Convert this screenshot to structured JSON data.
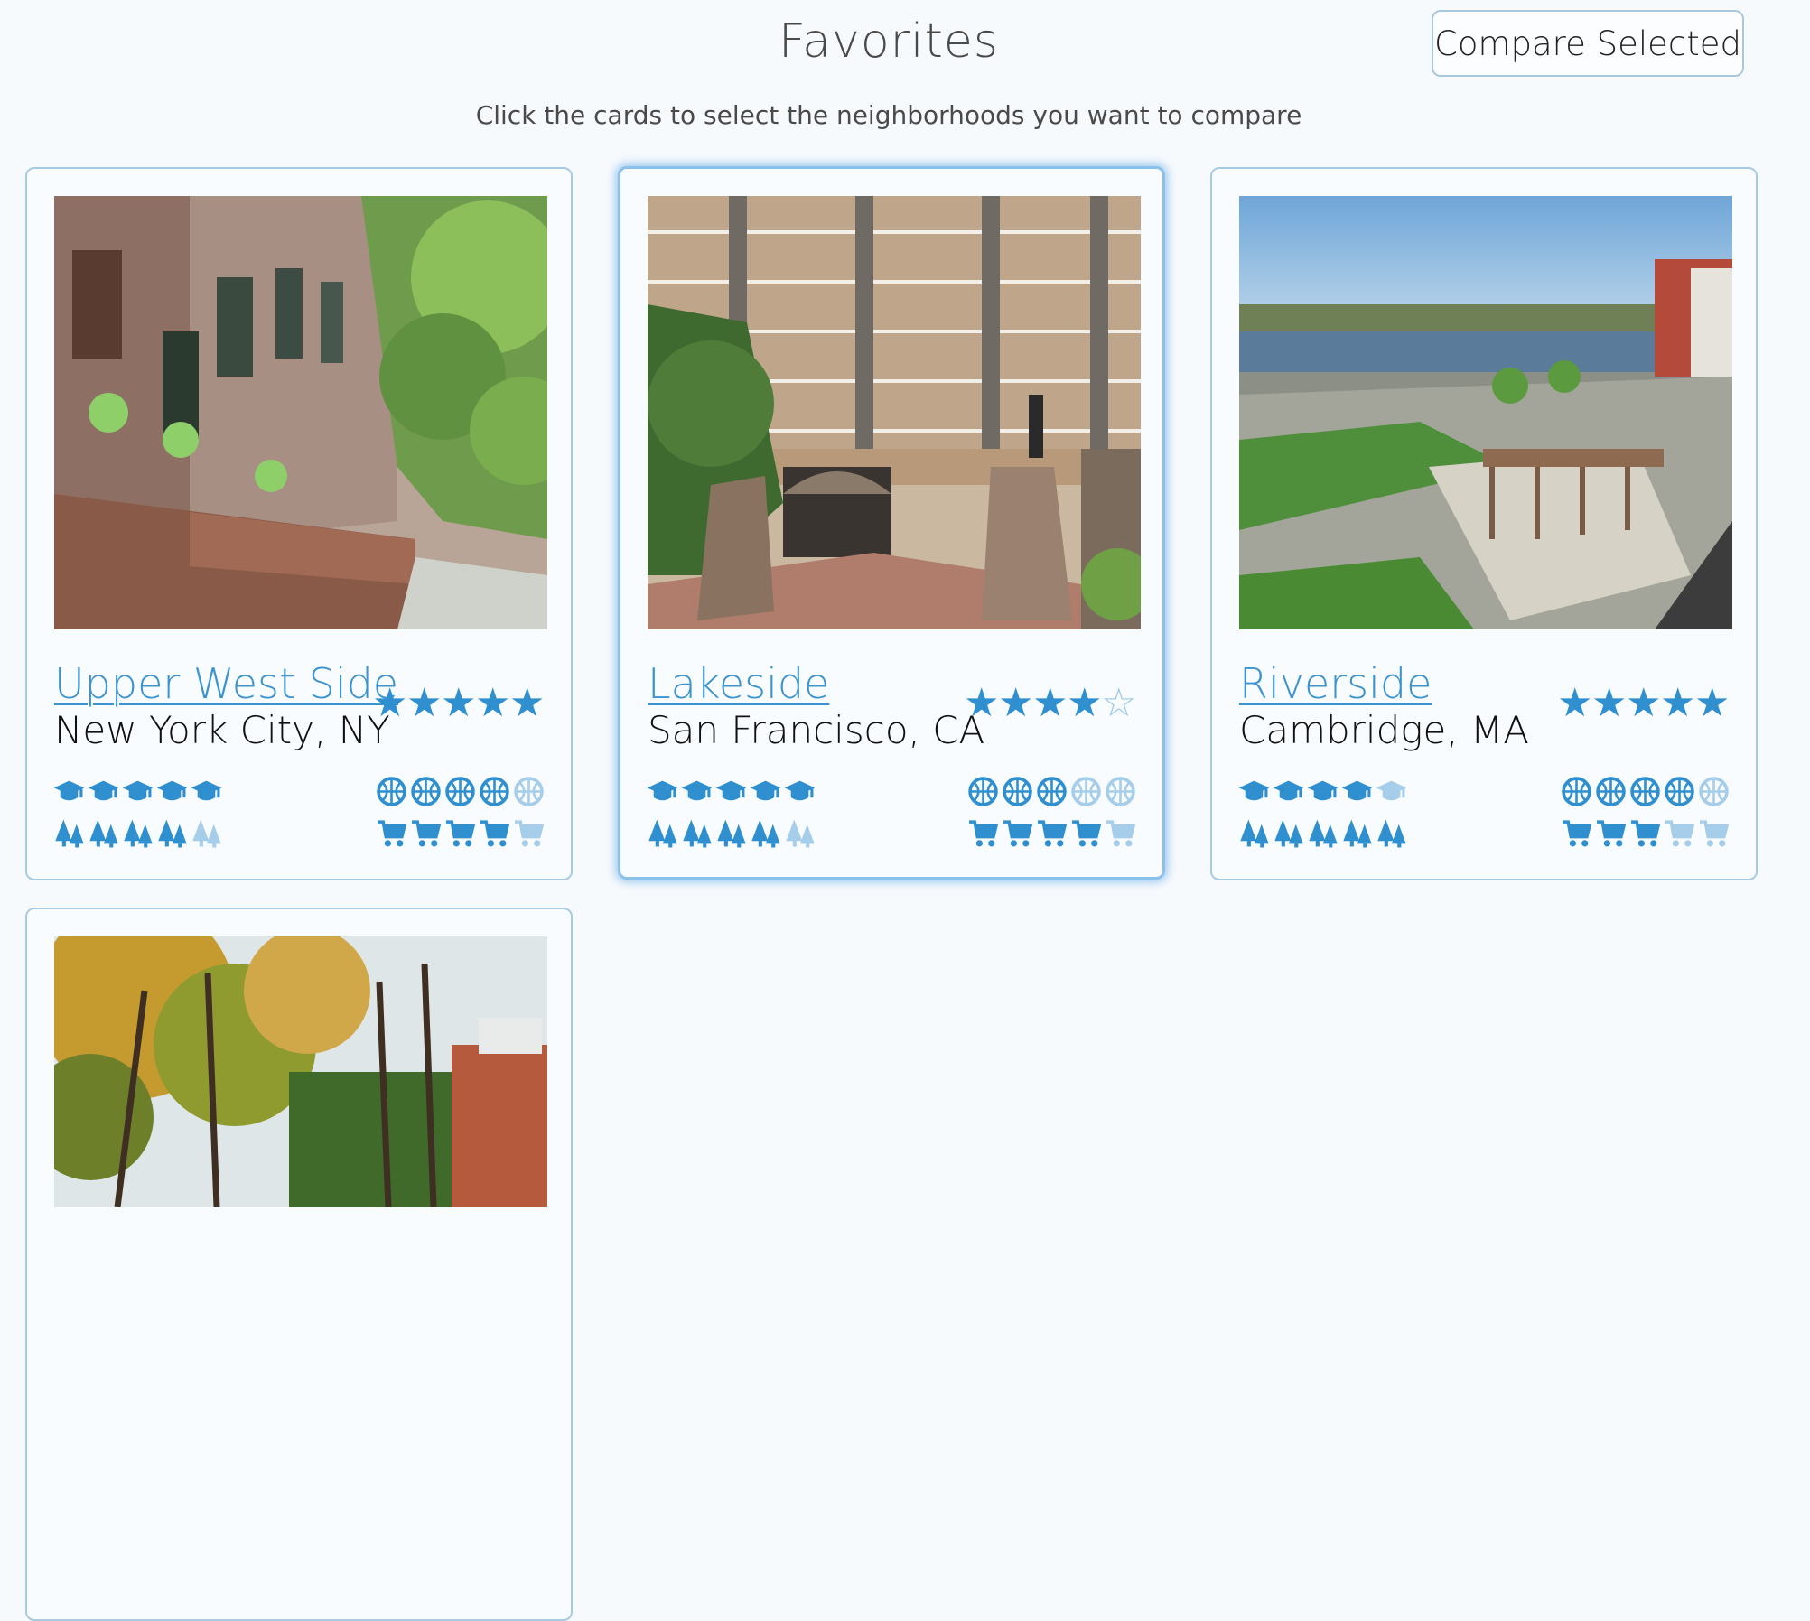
{
  "header": {
    "title": "Favorites",
    "compare_label": "Compare Selected",
    "subtitle": "Click the cards to select the neighborhoods you want to compare"
  },
  "icons": {
    "star": "star-icon",
    "schools": "graduation-cap-icon",
    "recreation": "basketball-icon",
    "parks": "tree-icon",
    "shopping": "shopping-cart-icon"
  },
  "colors": {
    "accent": "#3b93cf",
    "icon_filled": "#2f8fcf",
    "icon_faded": "#a6cdea",
    "selected_glow": "#8cc1ec"
  },
  "cards": [
    {
      "name": "Upper West Side",
      "city": "New York City, NY",
      "selected": false,
      "stars": 5,
      "schools": 5,
      "recreation": 4,
      "parks": 4,
      "shopping": 4
    },
    {
      "name": "Lakeside",
      "city": "San Francisco, CA",
      "selected": true,
      "stars": 4,
      "schools": 5,
      "recreation": 3,
      "parks": 4,
      "shopping": 4
    },
    {
      "name": "Riverside",
      "city": "Cambridge, MA",
      "selected": false,
      "stars": 5,
      "schools": 4,
      "recreation": 4,
      "parks": 5,
      "shopping": 3
    },
    {
      "name": "",
      "city": "",
      "selected": false
    }
  ]
}
